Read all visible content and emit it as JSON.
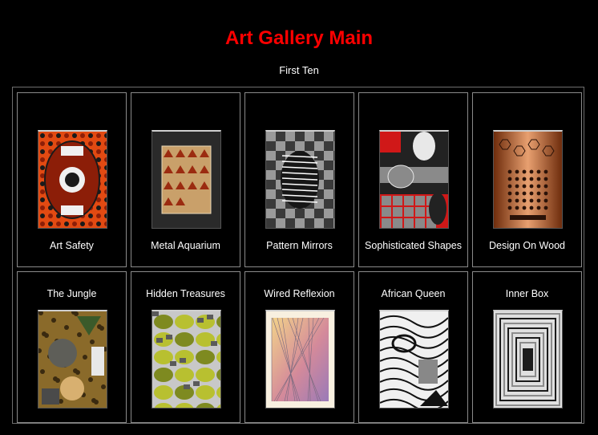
{
  "page": {
    "title": "Art Gallery Main",
    "subtitle": "First Ten",
    "title_color": "#ff0000",
    "background": "#000000"
  },
  "gallery": {
    "items": [
      {
        "label": "Art Safety",
        "palette": [
          "#e24a12",
          "#8c1e08",
          "#f0f0f0",
          "#1a1a1a"
        ]
      },
      {
        "label": "Metal Aquarium",
        "palette": [
          "#2a2a2a",
          "#c9a06a",
          "#9b2b10",
          "#e8d8b8"
        ]
      },
      {
        "label": "Pattern Mirrors",
        "palette": [
          "#3a3a3a",
          "#9a9a9a",
          "#ffffff",
          "#161616"
        ]
      },
      {
        "label": "Sophisticated Shapes",
        "palette": [
          "#d01818",
          "#8a8a8a",
          "#e8e8e8",
          "#222222"
        ]
      },
      {
        "label": "Design On Wood",
        "palette": [
          "#b0551e",
          "#6e2c0c",
          "#e8a070",
          "#2a1208"
        ]
      },
      {
        "label": "The Jungle",
        "palette": [
          "#8a6a2a",
          "#5e5e58",
          "#d8b070",
          "#3a5a2a"
        ]
      },
      {
        "label": "Hidden Treasures",
        "palette": [
          "#b8c030",
          "#7e8a20",
          "#c8c8c8",
          "#5a5a5a"
        ]
      },
      {
        "label": "Wired Reflexion",
        "palette": [
          "#f2d28a",
          "#d48a9a",
          "#9a7ab8",
          "#f8f0e0"
        ]
      },
      {
        "label": "African Queen",
        "palette": [
          "#f0f0f0",
          "#111111",
          "#888888",
          "#c8c8c8"
        ]
      },
      {
        "label": "Inner Box",
        "palette": [
          "#e0e0e0",
          "#1c1c1c",
          "#8c8c8c",
          "#ffffff"
        ]
      }
    ]
  }
}
